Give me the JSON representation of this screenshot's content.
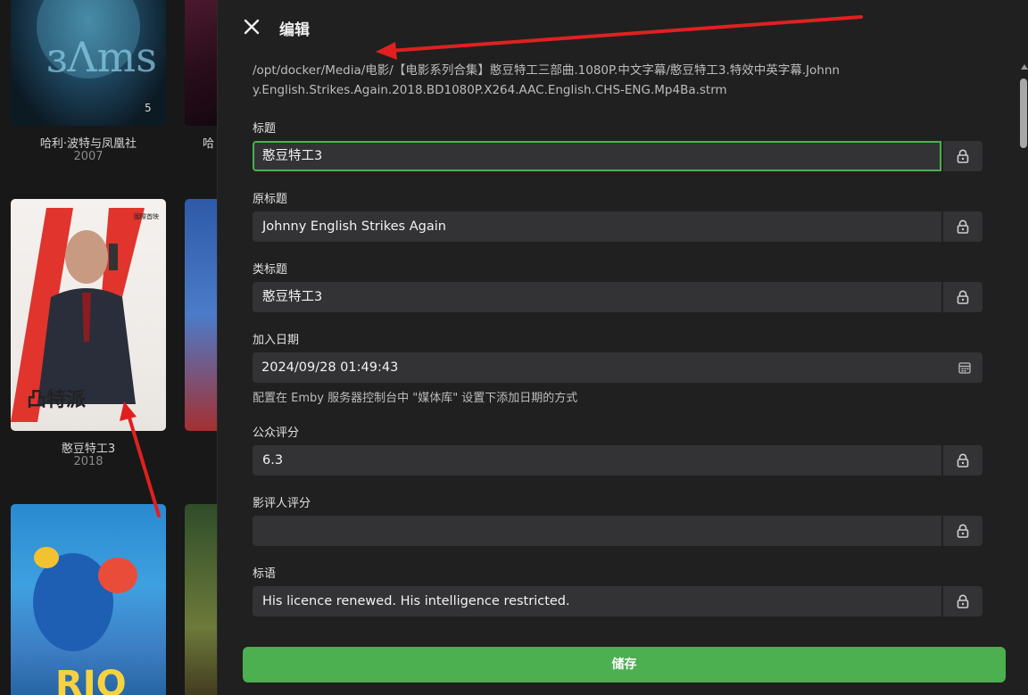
{
  "library": {
    "cards": [
      {
        "title": "哈利·波特与凤凰社",
        "year": "2007"
      },
      {
        "title": "哈",
        "year": ""
      },
      {
        "title": "憨豆特工3",
        "year": "2018"
      }
    ]
  },
  "panel": {
    "title": "编辑",
    "file_path": "/opt/docker/Media/电影/【电影系列合集】憨豆特工三部曲.1080P.中文字幕/憨豆特工3.特效中英字幕.Johnny.English.Strikes.Again.2018.BD1080P.X264.AAC.English.CHS-ENG.Mp4Ba.strm",
    "fields": {
      "title": {
        "label": "标题",
        "value": "憨豆特工3"
      },
      "original_title": {
        "label": "原标题",
        "value": "Johnny English Strikes Again"
      },
      "sort_title": {
        "label": "类标题",
        "value": "憨豆特工3"
      },
      "date_added": {
        "label": "加入日期",
        "value": "2024/09/28 01:49:43",
        "hint": "配置在 Emby 服务器控制台中 \"媒体库\" 设置下添加日期的方式"
      },
      "community_rating": {
        "label": "公众评分",
        "value": "6.3"
      },
      "critic_rating": {
        "label": "影评人评分",
        "value": ""
      },
      "tagline": {
        "label": "标语",
        "value": "His licence renewed. His intelligence restricted."
      }
    },
    "save_label": "储存"
  },
  "colors": {
    "accent": "#4caf50",
    "panel_bg": "#202020",
    "input_bg": "#333336",
    "annotation_arrow": "#e02020"
  },
  "icons": [
    "close-icon",
    "lock-icon",
    "calendar-icon"
  ]
}
